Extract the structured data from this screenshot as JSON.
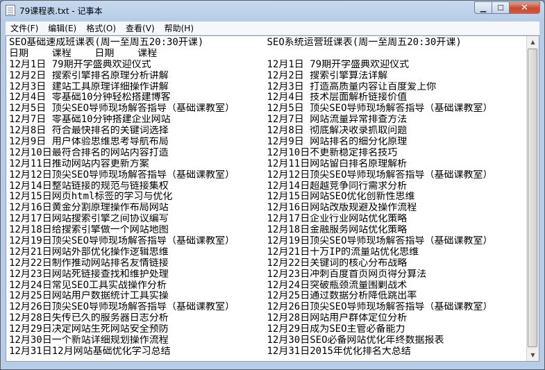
{
  "window": {
    "title": "79课程表.txt - 记事本",
    "controls": {
      "minimize": "▁",
      "maximize": "☐",
      "close": "✕"
    }
  },
  "menu": [
    "文件(F)",
    "编辑(E)",
    "格式(O)",
    "查看(V)",
    "帮助(H)"
  ],
  "document": {
    "lines": [
      [
        "SEO基础速成班课表(周一至周五20:30开课)",
        "SEO系统运营班课表(周一至周五20:30开课)"
      ],
      [
        "日期    课程    日期    课程",
        ""
      ],
      [
        "12月1日 79期开学盛典欢迎仪式",
        "12月1日 79期开学盛典欢迎仪式"
      ],
      [
        "12月2日 搜索引擎排名原理分析讲解",
        "12月2日 搜索引擎算法详解"
      ],
      [
        "12月3日 建站工具原理详细操作讲解",
        "12月3日 打造高质量内容让百度爱上你"
      ],
      [
        "12月4日 零基础10分钟轻松搭建博客",
        "12月4日 技术层面解析链接价值"
      ],
      [
        "12月5日 顶尖SEO导师现场解答指导（基础课教室）",
        "12月5日 顶尖SEO导师现场解答指导（基础课教室）"
      ],
      [
        "12月7日 零基础10分钟搭建企业网站",
        "12月7日 网站流量异常排查方法"
      ],
      [
        "12月8日 符合最快排名的关键词选择",
        "12月8日 彻底解决收录抓取问题"
      ],
      [
        "12月9日 用户体验思维思考导航布局",
        "12月9日 网站排名的细分化原理"
      ],
      [
        "12月10日最符合排名的网站内容打造",
        "12月10日不更新稳定排名技巧"
      ],
      [
        "12月11日推动网站内容更新方案",
        "12月11日网站留白排名原理解析"
      ],
      [
        "12月12日顶尖SEO导师现场解答指导（基础课教室）",
        "12月12日顶尖SEO导师现场解答指导（基础课教室）"
      ],
      [
        "12月14日整站链接的规范与链接集权",
        "12月14日超越竞争同行需求分析"
      ],
      [
        "12月15日网页html标签的学习与优化",
        "12月15日网站SEO优化创新性思维"
      ],
      [
        "12月16日黄金分割原理操作布局网站",
        "12月16日网站改版规避及操作流程"
      ],
      [
        "12月17日网站搜索引擎之间协议编写",
        "12月17日企业行业网站优化策略"
      ],
      [
        "12月18日给搜索引擎做一个网站地图",
        "12月18日金融服务网站优化策略"
      ],
      [
        "12月19日顶尖SEO导师现场解答指导（基础课教室）",
        "12月19日顶尖SEO导师现场解答指导（基础课教室）"
      ],
      [
        "12月21日网站外部优化操作逻辑思维",
        "12月21日十万IP的流量站优化思维"
      ],
      [
        "12月22日制作推动网站排名友情链接",
        "12月22日关键词的核心分布战略"
      ],
      [
        "12月23日网站死链接查找和维护处理",
        "12月23日冲刺百度首页网页得分算法"
      ],
      [
        "12月24日常见SEO工具实战操作分析",
        "12月24日突破瓶颈流量围剿战术"
      ],
      [
        "12月25日网站用户数据统计工具实操",
        "12月25日通过数据分析降低跳出率"
      ],
      [
        "12月26日顶尖SEO导师现场解答指导（基础课教室）",
        "12月26日顶尖SEO导师现场解答指导（基础课教室）"
      ],
      [
        "12月28日失传已久的服务器日志分析",
        "12月28日网站用户群体定位分析"
      ],
      [
        "12月29日决定网站生死网站安全预防",
        "12月29日成为SEO主管必备能力"
      ],
      [
        "12月30日一个新站详细规划操作流程",
        "12月30日SEO必备网站优化年终数据报表"
      ],
      [
        "12月31日12月网站基础优化学习总结",
        "12月31日2015年优化排名大总结"
      ]
    ]
  }
}
